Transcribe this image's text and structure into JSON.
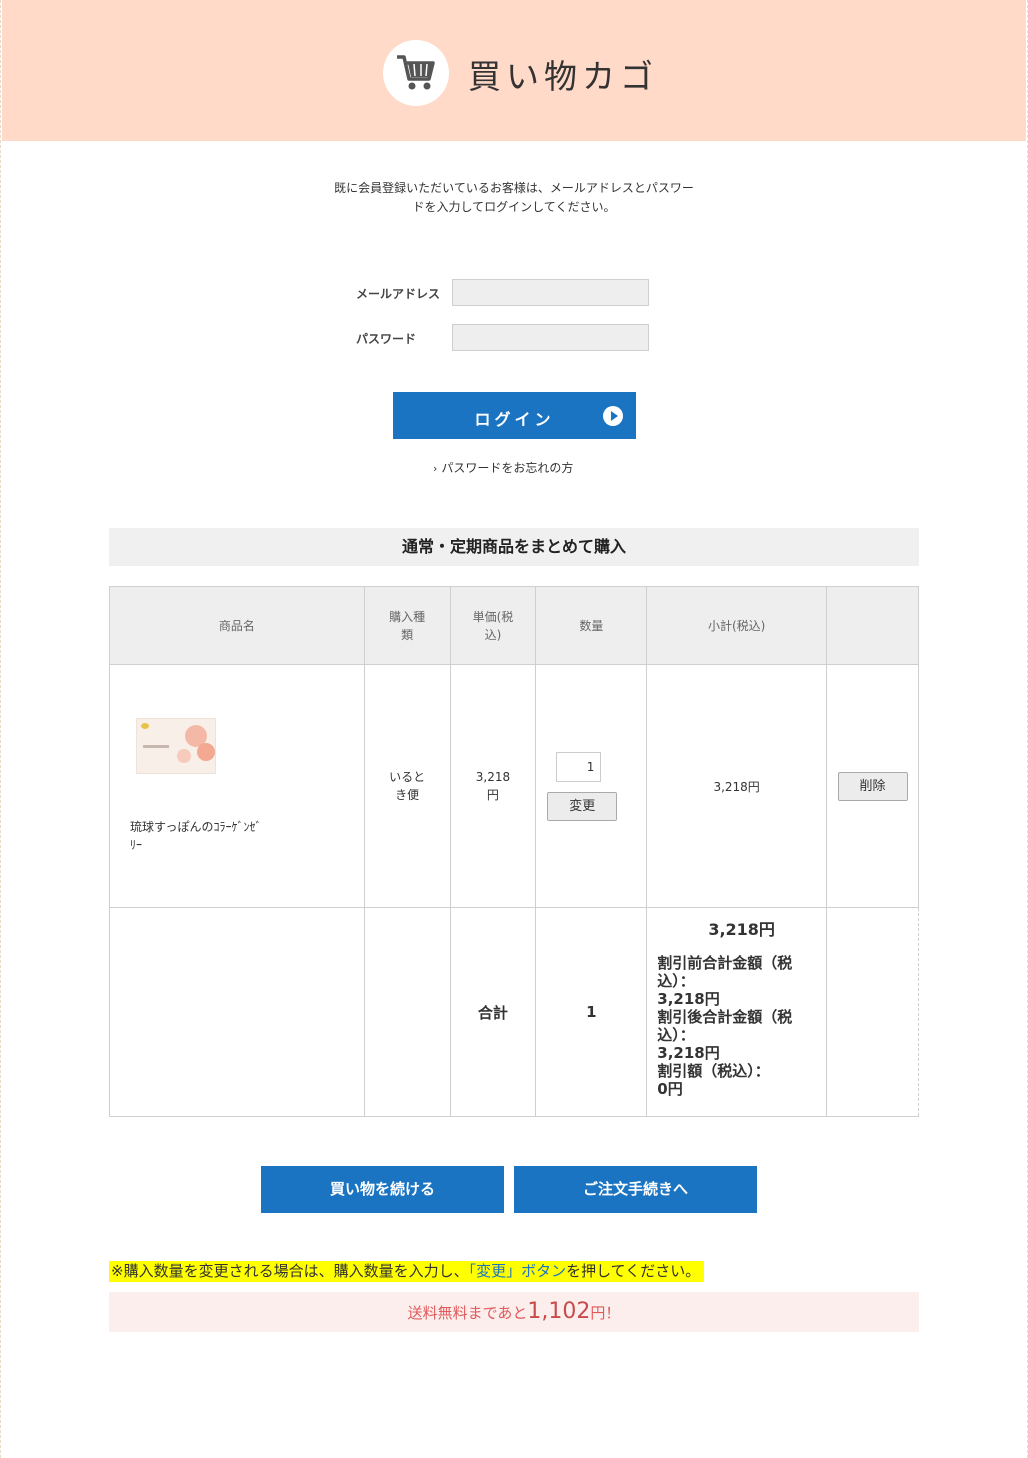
{
  "header": {
    "title": "買い物カゴ",
    "icon": "shopping-cart-icon"
  },
  "login": {
    "intro_line1": "既に会員登録いただいているお客様は、メールアドレスとパスワー",
    "intro_line2": "ドを入力してログインしてください。",
    "email_label": "メールアドレス",
    "email_value": "",
    "password_label": "パスワード",
    "password_value": "",
    "button_label": "ログイン",
    "forgot_label": "パスワードをお忘れの方"
  },
  "section_title": "通常・定期商品をまとめて購入",
  "table": {
    "headers": {
      "name": "商品名",
      "type_l1": "購入種",
      "type_l2": "類",
      "price_l1": "単価(税",
      "price_l2": "込)",
      "qty": "数量",
      "subtotal": "小計(税込)",
      "action": ""
    },
    "item": {
      "name_l1": "琉球すっぽんのｺﾗｰｹﾞﾝｾﾞ",
      "name_l2": "ﾘｰ",
      "type_l1": "いると",
      "type_l2": "き便",
      "price_l1": "3,218",
      "price_l2": "円",
      "qty": "1",
      "change_label": "変更",
      "subtotal": "3,218円",
      "delete_label": "削除"
    },
    "total": {
      "label": "合計",
      "qty": "1",
      "amount": "3,218円",
      "lines": [
        "割引前合計金額（税",
        "込）：",
        "3,218円",
        "割引後合計金額（税",
        "込）：",
        "3,218円",
        "割引額（税込）：",
        "0円"
      ]
    }
  },
  "actions": {
    "continue_label": "買い物を続ける",
    "checkout_label": "ご注文手続きへ"
  },
  "notice": {
    "before": "※購入数量を変更される場合は、購入数量を入力し、",
    "highlight": "「変更」ボタン",
    "after": "を押してください。"
  },
  "shipping": {
    "before": "送料無料まであと",
    "amount": "1,102",
    "after": "円！"
  },
  "colors": {
    "header_bg": "#ffdac8",
    "accent_blue": "#1a74c2",
    "notice_bg": "#ffff00",
    "shipping_text": "#e05a5a"
  }
}
